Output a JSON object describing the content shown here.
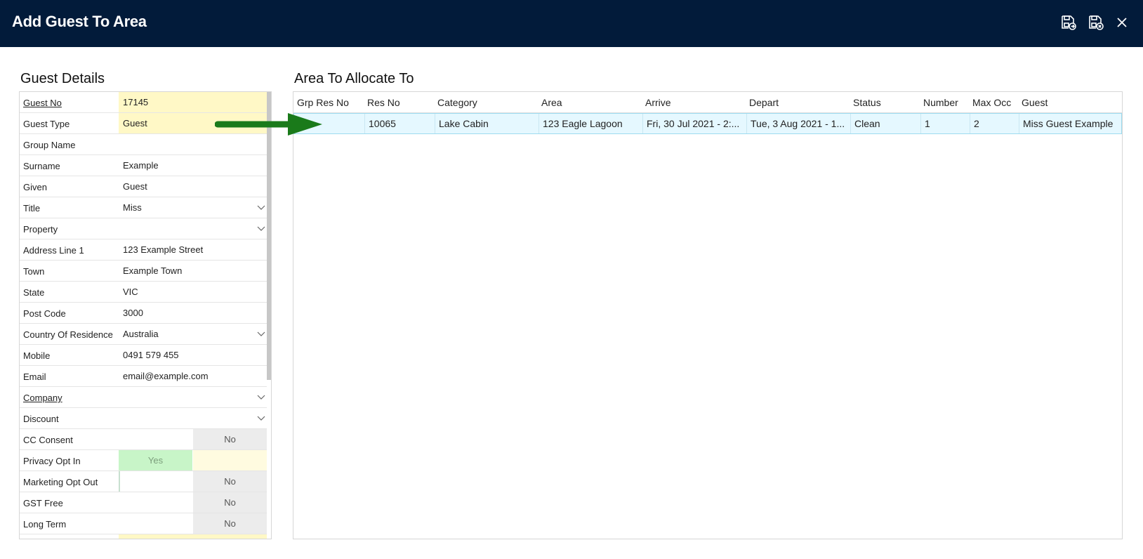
{
  "window": {
    "title": "Add Guest To Area",
    "icons": [
      "save-close-icon",
      "save-exit-icon",
      "close-icon"
    ],
    "colors": {
      "titlebar": "#021b3a",
      "selected_row": "#e5f8ff",
      "highlight_field": "#fff8c6",
      "yes_toggle": "#c8f5c8",
      "arrow": "#1a7a1a"
    }
  },
  "guest_details": {
    "heading": "Guest Details",
    "fields": [
      {
        "label": "Guest No",
        "value": "17145"
      },
      {
        "label": "Guest Type",
        "value": "Guest"
      },
      {
        "label": "Group Name",
        "value": ""
      },
      {
        "label": "Surname",
        "value": "Example"
      },
      {
        "label": "Given",
        "value": "Guest"
      },
      {
        "label": "Title",
        "value": "Miss"
      },
      {
        "label": "Property",
        "value": ""
      },
      {
        "label": "Address Line 1",
        "value": "123 Example Street"
      },
      {
        "label": "Town",
        "value": "Example Town"
      },
      {
        "label": "State",
        "value": "VIC"
      },
      {
        "label": "Post Code",
        "value": "3000"
      },
      {
        "label": "Country Of Residence",
        "value": "Australia"
      },
      {
        "label": "Mobile",
        "value": "0491 579 455"
      },
      {
        "label": "Email",
        "value": "email@example.com"
      },
      {
        "label": "Company",
        "value": ""
      },
      {
        "label": "Discount",
        "value": ""
      }
    ],
    "toggles": [
      {
        "label": "CC Consent",
        "yes": "",
        "no": "No"
      },
      {
        "label": "Privacy Opt In",
        "yes": "Yes",
        "no": ""
      },
      {
        "label": "Marketing Opt Out",
        "yes": "",
        "no": "No"
      },
      {
        "label": "GST Free",
        "yes": "",
        "no": "No"
      },
      {
        "label": "Long Term",
        "yes": "",
        "no": "No"
      }
    ]
  },
  "area_table": {
    "heading": "Area To Allocate To",
    "columns": [
      "Grp Res No",
      "Res No",
      "Category",
      "Area",
      "Arrive",
      "Depart",
      "Status",
      "Number",
      "Max Occ",
      "Guest"
    ],
    "rows": [
      [
        "",
        "10065",
        "Lake Cabin",
        "123 Eagle Lagoon",
        "Fri, 30 Jul 2021 - 2:...",
        "Tue, 3 Aug 2021 - 1...",
        "Clean",
        "1",
        "2",
        "Miss Guest Example"
      ]
    ]
  }
}
